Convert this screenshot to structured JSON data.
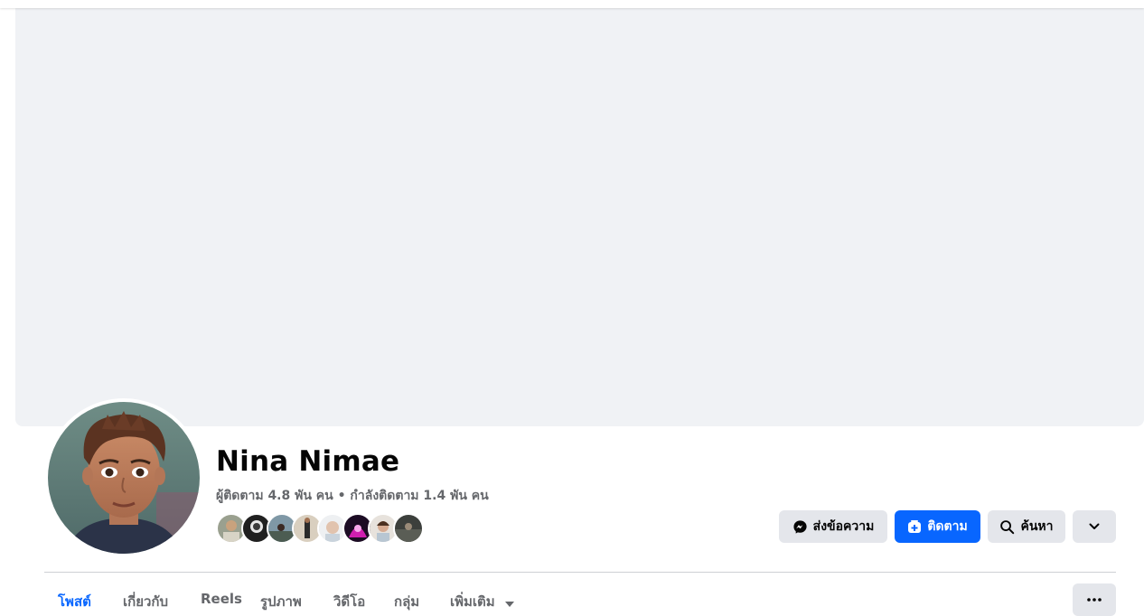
{
  "profile": {
    "name": "Nina Nimae",
    "stats": "ผู้ติดตาม 4.8 พัน คน • กำลังติดตาม 1.4 พัน คน"
  },
  "actions": {
    "message_label": "ส่งข้อความ",
    "follow_label": "ติดตาม",
    "search_label": "ค้นหา"
  },
  "tabs": [
    {
      "label": "โพสต์",
      "active": true
    },
    {
      "label": "เกี่ยวกับ"
    },
    {
      "label": "Reels"
    },
    {
      "label": "รูปภาพ"
    },
    {
      "label": "วิดีโอ"
    },
    {
      "label": "กลุ่ม"
    },
    {
      "label": "เพิ่มเติม"
    }
  ],
  "colors": {
    "accent": "#0866ff",
    "cover": "#f0f2f5",
    "button_grey": "#e4e6eb",
    "secondary_text": "#65676b"
  },
  "icons": {
    "message": "messenger-icon",
    "follow": "follow-icon",
    "search": "search-icon",
    "expand": "chevron-down-icon",
    "more": "more-dots-icon"
  }
}
